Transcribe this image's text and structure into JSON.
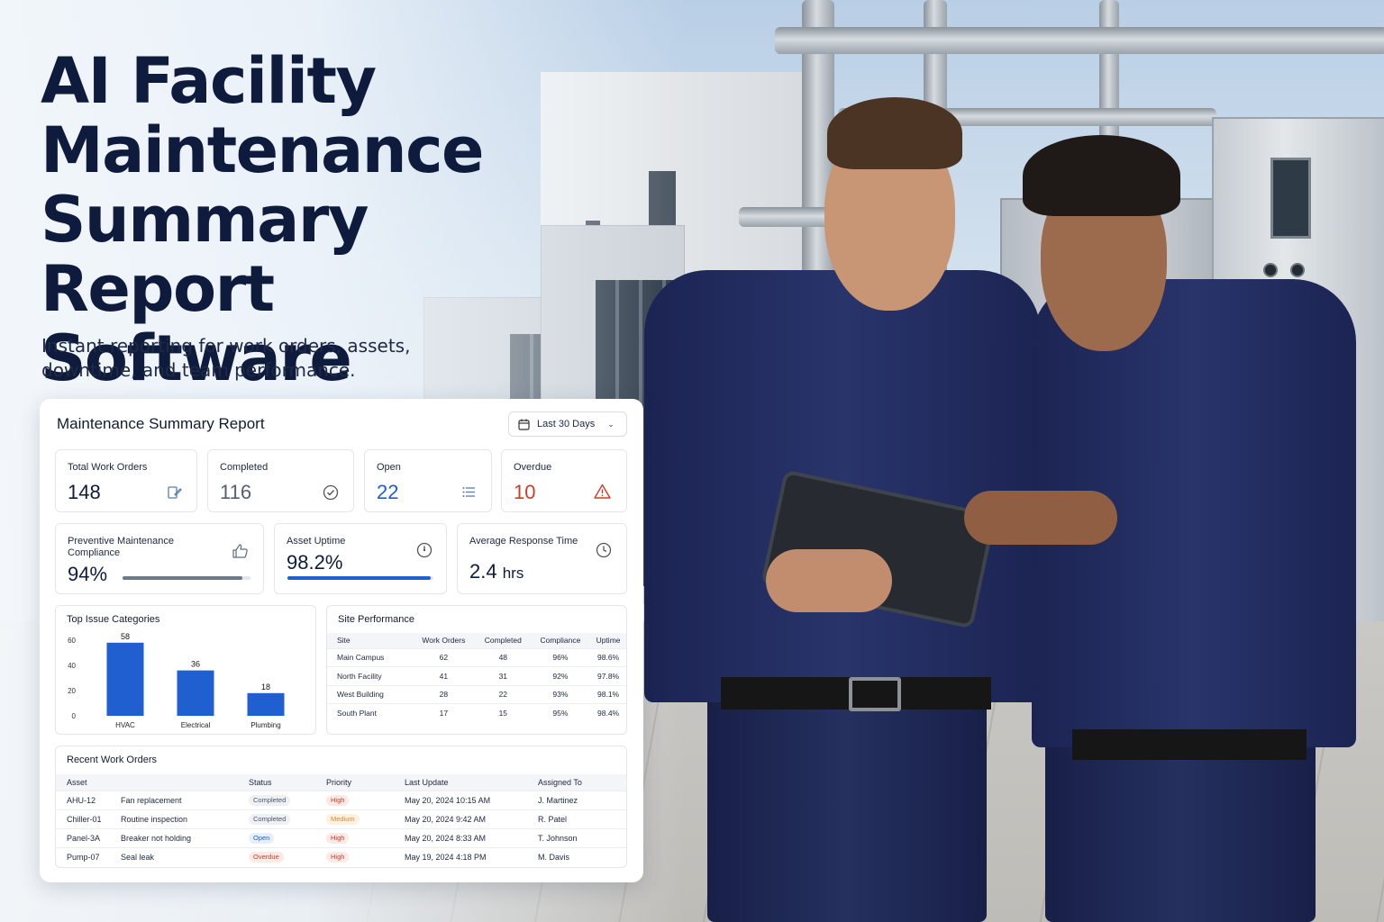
{
  "hero": {
    "title_line1": "AI Facility",
    "title_line2": "Maintenance",
    "title_line3": "Summary Report",
    "title_line4": "Software",
    "subtitle_line1": "Instant reporting for work orders, assets,",
    "subtitle_line2": "downtime, and team performance."
  },
  "report": {
    "title": "Maintenance Summary Report",
    "date_range": "Last 30 Days",
    "kpis": {
      "total": {
        "label": "Total Work Orders",
        "value": "148",
        "icon": "document-edit-icon"
      },
      "completed": {
        "label": "Completed",
        "value": "116",
        "icon": "check-circle-icon"
      },
      "open": {
        "label": "Open",
        "value": "22",
        "icon": "list-icon"
      },
      "overdue": {
        "label": "Overdue",
        "value": "10",
        "icon": "warning-triangle-icon"
      }
    },
    "metrics": {
      "pm": {
        "label_line1": "Preventive Maintenance",
        "label_line2": "Compliance",
        "value": "94%",
        "progress": 0.94,
        "icon": "thumbs-up-icon"
      },
      "uptime": {
        "label": "Asset Uptime",
        "value": "98.2%",
        "progress": 0.982,
        "icon": "gauge-icon"
      },
      "response": {
        "label": "Average Response Time",
        "value": "2.4",
        "unit": "hrs",
        "icon": "clock-icon"
      }
    },
    "colors": {
      "accent": "#1f5fd0",
      "danger": "#d43b25",
      "pm_bar": "#6b7a86",
      "text": "#0f1b3d"
    }
  },
  "chart_data": {
    "type": "bar",
    "title": "Top Issue Categories",
    "categories": [
      "HVAC",
      "Electrical",
      "Plumbing"
    ],
    "values": [
      58,
      36,
      18
    ],
    "yticks": [
      0,
      20,
      40,
      60
    ],
    "ylim": [
      0,
      60
    ],
    "color": "#1f5fd0",
    "data_labels": true
  },
  "site_performance": {
    "title": "Site Performance",
    "headers": [
      "Site",
      "Work Orders",
      "Completed",
      "Compliance",
      "Uptime"
    ],
    "rows": [
      [
        "Main Campus",
        "62",
        "48",
        "96%",
        "98.6%"
      ],
      [
        "North Facility",
        "41",
        "31",
        "92%",
        "97.8%"
      ],
      [
        "West Building",
        "28",
        "22",
        "93%",
        "98.1%"
      ],
      [
        "South Plant",
        "17",
        "15",
        "95%",
        "98.4%"
      ]
    ]
  },
  "recent_work_orders": {
    "title": "Recent Work Orders",
    "headers": [
      "Asset",
      "Status",
      "Priority",
      "Last Update",
      "Assigned To"
    ],
    "rows": [
      {
        "asset": "AHU-12",
        "desc": "Fan replacement",
        "status": "Completed",
        "priority": "High",
        "updated": "May 20, 2024 10:15 AM",
        "assignee": "J. Martinez"
      },
      {
        "asset": "Chiller-01",
        "desc": "Routine inspection",
        "status": "Completed",
        "priority": "Medium",
        "updated": "May 20, 2024 9:42 AM",
        "assignee": "R. Patel"
      },
      {
        "asset": "Panel-3A",
        "desc": "Breaker not holding",
        "status": "Open",
        "priority": "High",
        "updated": "May 20, 2024 8:33 AM",
        "assignee": "T. Johnson"
      },
      {
        "asset": "Pump-07",
        "desc": "Seal leak",
        "status": "Overdue",
        "priority": "High",
        "updated": "May 19, 2024 4:18 PM",
        "assignee": "M. Davis"
      }
    ],
    "status_colors": {
      "Completed": {
        "bg": "#eef0f4",
        "fg": "#4a5568"
      },
      "Open": {
        "bg": "#e6effc",
        "fg": "#1f5fd0"
      },
      "Overdue": {
        "bg": "#fde9e5",
        "fg": "#d43b25"
      }
    },
    "priority_colors": {
      "High": {
        "bg": "#fde9e5",
        "fg": "#d43b25"
      },
      "Medium": {
        "bg": "#fdf1e2",
        "fg": "#e08a2c"
      }
    }
  }
}
